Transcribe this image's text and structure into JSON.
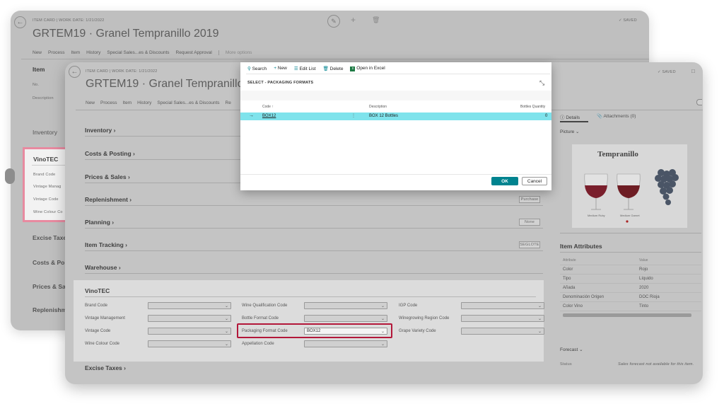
{
  "back_card": {
    "breadcrumb": "ITEM CARD | WORK DATE: 1/21/2022",
    "title": "GRTEM19 · Granel Tempranillo 2019",
    "actions": [
      "New",
      "Process",
      "Item",
      "History",
      "Special Sales...es & Discounts",
      "Request Approval",
      "More options"
    ],
    "saved": "SAVED",
    "sections": [
      "Item",
      "Inventory",
      "VinoTEC",
      "Excise Taxes",
      "Costs & Pos",
      "Prices & Sal",
      "Replenishm"
    ],
    "item_fields": [
      "No.",
      "Description"
    ],
    "vinotec_fields": [
      "Brand Code",
      "Vintage Manag",
      "Vintage Code",
      "Wine Colour Co"
    ]
  },
  "front_card": {
    "breadcrumb": "ITEM CARD | WORK DATE: 1/21/2022",
    "title": "GRTEM19 · Granel Tempranillo 2019",
    "saved": "SAVED",
    "actions": [
      "New",
      "Process",
      "Item",
      "History",
      "Special Sales...es & Discounts",
      "Re"
    ],
    "sections": {
      "inventory": "Inventory",
      "costs": "Costs & Posting",
      "prices": "Prices & Sales",
      "replenishment": "Replenishment",
      "planning": "Planning",
      "item_tracking": "Item Tracking",
      "warehouse": "Warehouse",
      "excise": "Excise Taxes"
    },
    "section_values": {
      "replenishment": "Purchase",
      "planning": "None",
      "item_tracking": "SEGLOTE"
    },
    "vinotec": {
      "title": "VinoTEC",
      "col1": [
        {
          "label": "Brand Code",
          "value": ""
        },
        {
          "label": "Vintage Management",
          "value": ""
        },
        {
          "label": "Vintage Code",
          "value": ""
        },
        {
          "label": "Wine Colour Code",
          "value": ""
        }
      ],
      "col2": [
        {
          "label": "Wine Qualification Code",
          "value": ""
        },
        {
          "label": "Bottle Format Code",
          "value": ""
        },
        {
          "label": "Packaging Format Code",
          "value": "BOX12"
        },
        {
          "label": "Appellation Code",
          "value": ""
        }
      ],
      "col3": [
        {
          "label": "IGP Code",
          "value": ""
        },
        {
          "label": "Winegrowing Region Code",
          "value": ""
        },
        {
          "label": "Grape Variety Code",
          "value": ""
        }
      ]
    },
    "factbox": {
      "details_tab": "Details",
      "attachments_tab": "Attachments (0)",
      "picture_label": "Picture",
      "picture_title": "Tempranillo",
      "picture_caption_1": "Medium Ruby",
      "picture_caption_2": "Medium Garnet",
      "item_attributes": "Item Attributes",
      "attr_header": [
        "Attribute",
        "Value"
      ],
      "attributes": [
        {
          "name": "Color",
          "value": "Rojo"
        },
        {
          "name": "Tipo",
          "value": "Líquido"
        },
        {
          "name": "Añada",
          "value": "2020"
        },
        {
          "name": "Denominación Origen",
          "value": "DOC Rioja"
        },
        {
          "name": "Color Vino",
          "value": "Tinto"
        }
      ],
      "forecast": "Forecast",
      "status_label": "Status",
      "status_value": "Sales forecast not available for this item."
    }
  },
  "modal": {
    "toolbar": [
      "Search",
      "New",
      "Edit List",
      "Delete",
      "Open in Excel"
    ],
    "title": "SELECT - PACKAGING FORMATS",
    "columns": [
      "Code ↑",
      "Description",
      "Bottles Quantity"
    ],
    "row": {
      "code": "BOX12",
      "description": "BOX 12 Bottles",
      "qty": "0"
    },
    "ok": "OK",
    "cancel": "Cancel"
  },
  "colors": {
    "accent": "#00838f",
    "selected_row": "#7fe3ec",
    "highlight": "#b3173a"
  }
}
